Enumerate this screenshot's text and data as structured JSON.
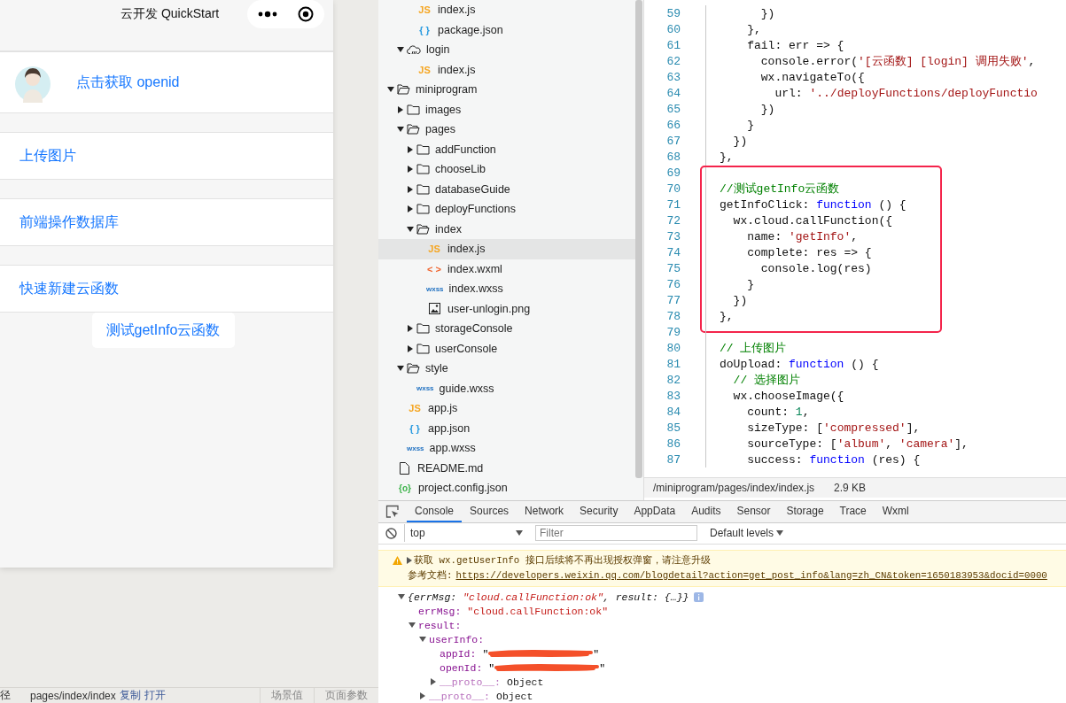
{
  "simulator": {
    "title": "云开发 QuickStart",
    "menu": [
      {
        "kind": "avatar",
        "label": "点击获取 openid"
      },
      {
        "kind": "plain",
        "label": "上传图片"
      },
      {
        "kind": "plain",
        "label": "前端操作数据库"
      },
      {
        "kind": "plain",
        "label": "快速新建云函数"
      },
      {
        "kind": "button",
        "label": "测试getInfo云函数"
      }
    ],
    "status_bar": {
      "path_label": "径",
      "path": "pages/index/index",
      "actions": [
        "复制",
        "打开"
      ],
      "buttons": [
        "场景值",
        "页面参数"
      ]
    }
  },
  "file_tree": {
    "items": [
      {
        "children": [
          {
            "children": [
              {
                "kind": "js",
                "badge": "JS",
                "label": "index.js",
                "selected": false
              },
              {
                "kind": "json",
                "badge": "{ }",
                "label": "package.json",
                "selected": false
              }
            ]
          },
          {
            "kind": "cloud-folder",
            "label": "login",
            "expanded": true,
            "children": [
              {
                "kind": "js",
                "badge": "JS",
                "label": "index.js",
                "selected": false
              }
            ]
          }
        ]
      },
      {
        "kind": "folder",
        "label": "miniprogram",
        "expanded": true,
        "children": [
          {
            "kind": "folder",
            "label": "images",
            "expanded": false
          },
          {
            "kind": "folder",
            "label": "pages",
            "expanded": true,
            "children": [
              {
                "kind": "folder",
                "label": "addFunction",
                "expanded": false
              },
              {
                "kind": "folder",
                "label": "chooseLib",
                "expanded": false
              },
              {
                "kind": "folder",
                "label": "databaseGuide",
                "expanded": false
              },
              {
                "kind": "folder",
                "label": "deployFunctions",
                "expanded": false
              },
              {
                "kind": "folder",
                "label": "index",
                "expanded": true,
                "children": [
                  {
                    "kind": "js",
                    "badge": "JS",
                    "label": "index.js",
                    "selected": true
                  },
                  {
                    "kind": "wxml",
                    "badge": "< >",
                    "label": "index.wxml",
                    "selected": false
                  },
                  {
                    "kind": "wxss",
                    "badge": "wxss",
                    "label": "index.wxss",
                    "selected": false
                  },
                  {
                    "kind": "image",
                    "label": "user-unlogin.png",
                    "selected": false
                  }
                ]
              },
              {
                "kind": "folder",
                "label": "storageConsole",
                "expanded": false
              },
              {
                "kind": "folder",
                "label": "userConsole",
                "expanded": false
              }
            ]
          },
          {
            "kind": "folder",
            "label": "style",
            "expanded": true,
            "children": [
              {
                "kind": "wxss",
                "badge": "wxss",
                "label": "guide.wxss",
                "selected": false
              }
            ]
          },
          {
            "kind": "js",
            "badge": "JS",
            "label": "app.js",
            "selected": false
          },
          {
            "kind": "json",
            "badge": "{ }",
            "label": "app.json",
            "selected": false
          },
          {
            "kind": "wxss",
            "badge": "wxss",
            "label": "app.wxss",
            "selected": false
          }
        ]
      },
      {
        "kind": "file",
        "label": "README.md",
        "selected": false
      },
      {
        "kind": "config",
        "badge": "{o}",
        "label": "project.config.json",
        "selected": false
      }
    ]
  },
  "editor": {
    "sections": [
      {
        "highlighted": false,
        "lines": [
          {
            "number": "59",
            "tokens": [
              {
                "kind": "plain",
                "text": "      })"
              }
            ]
          },
          {
            "number": "60",
            "tokens": [
              {
                "kind": "plain",
                "text": "    },"
              }
            ]
          },
          {
            "number": "61",
            "tokens": [
              {
                "kind": "plain",
                "text": "    fail: err => {"
              }
            ]
          },
          {
            "number": "62",
            "tokens": [
              {
                "kind": "plain",
                "text": "      console.error("
              },
              {
                "kind": "string",
                "text": "'[云函数] [login] 调用失败'"
              },
              {
                "kind": "plain",
                "text": ","
              }
            ]
          },
          {
            "number": "63",
            "tokens": [
              {
                "kind": "plain",
                "text": "      wx.navigateTo({"
              }
            ]
          },
          {
            "number": "64",
            "tokens": [
              {
                "kind": "plain",
                "text": "        url: "
              },
              {
                "kind": "string",
                "text": "'../deployFunctions/deployFunctio"
              }
            ]
          },
          {
            "number": "65",
            "tokens": [
              {
                "kind": "plain",
                "text": "      })"
              }
            ]
          },
          {
            "number": "66",
            "tokens": [
              {
                "kind": "plain",
                "text": "    }"
              }
            ]
          },
          {
            "number": "67",
            "tokens": [
              {
                "kind": "plain",
                "text": "  })"
              }
            ]
          },
          {
            "number": "68",
            "tokens": [
              {
                "kind": "plain",
                "text": "},"
              }
            ]
          },
          {
            "number": "69"
          }
        ]
      },
      {
        "highlighted": true,
        "lines": [
          {
            "number": "70",
            "tokens": [
              {
                "kind": "comment",
                "text": "//测试getInfo云函数"
              }
            ]
          },
          {
            "number": "71",
            "tokens": [
              {
                "kind": "plain",
                "text": "getInfoClick: "
              },
              {
                "kind": "keyword",
                "text": "function"
              },
              {
                "kind": "plain",
                "text": " () {"
              }
            ]
          },
          {
            "number": "72",
            "tokens": [
              {
                "kind": "plain",
                "text": "  wx.cloud.callFunction({"
              }
            ]
          },
          {
            "number": "73",
            "tokens": [
              {
                "kind": "plain",
                "text": "    name: "
              },
              {
                "kind": "string",
                "text": "'getInfo'"
              },
              {
                "kind": "plain",
                "text": ","
              }
            ]
          },
          {
            "number": "74",
            "tokens": [
              {
                "kind": "plain",
                "text": "    complete: res => {"
              }
            ]
          },
          {
            "number": "75",
            "tokens": [
              {
                "kind": "plain",
                "text": "      console.log(res)"
              }
            ]
          },
          {
            "number": "76",
            "tokens": [
              {
                "kind": "plain",
                "text": "    }"
              }
            ]
          },
          {
            "number": "77",
            "tokens": [
              {
                "kind": "plain",
                "text": "  })"
              }
            ]
          },
          {
            "number": "78",
            "tokens": [
              {
                "kind": "plain",
                "text": "},"
              }
            ]
          }
        ]
      },
      {
        "highlighted": false,
        "lines": [
          {
            "number": "79"
          },
          {
            "number": "80",
            "tokens": [
              {
                "kind": "comment",
                "text": "// 上传图片"
              }
            ]
          },
          {
            "number": "81",
            "tokens": [
              {
                "kind": "plain",
                "text": "doUpload: "
              },
              {
                "kind": "keyword",
                "text": "function"
              },
              {
                "kind": "plain",
                "text": " () {"
              }
            ]
          },
          {
            "number": "82",
            "tokens": [
              {
                "kind": "comment",
                "text": "  // 选择图片"
              }
            ]
          },
          {
            "number": "83",
            "tokens": [
              {
                "kind": "plain",
                "text": "  wx.chooseImage({"
              }
            ]
          },
          {
            "number": "84",
            "tokens": [
              {
                "kind": "plain",
                "text": "    count: "
              },
              {
                "kind": "number",
                "text": "1"
              },
              {
                "kind": "plain",
                "text": ","
              }
            ]
          },
          {
            "number": "85",
            "tokens": [
              {
                "kind": "plain",
                "text": "    sizeType: ["
              },
              {
                "kind": "string",
                "text": "'compressed'"
              },
              {
                "kind": "plain",
                "text": "],"
              }
            ]
          },
          {
            "number": "86",
            "tokens": [
              {
                "kind": "plain",
                "text": "    sourceType: ["
              },
              {
                "kind": "string",
                "text": "'album'"
              },
              {
                "kind": "plain",
                "text": ", "
              },
              {
                "kind": "string",
                "text": "'camera'"
              },
              {
                "kind": "plain",
                "text": "],"
              }
            ]
          },
          {
            "number": "87",
            "tokens": [
              {
                "kind": "plain",
                "text": "    success: "
              },
              {
                "kind": "keyword",
                "text": "function"
              },
              {
                "kind": "plain",
                "text": " (res) {"
              }
            ]
          }
        ]
      }
    ],
    "status": {
      "path": "/miniprogram/pages/index/index.js",
      "size": "2.9 KB"
    }
  },
  "devtools": {
    "tabs": [
      {
        "label": "Console",
        "selected": true
      },
      {
        "label": "Sources",
        "selected": false
      },
      {
        "label": "Network",
        "selected": false
      },
      {
        "label": "Security",
        "selected": false
      },
      {
        "label": "AppData",
        "selected": false
      },
      {
        "label": "Audits",
        "selected": false
      },
      {
        "label": "Sensor",
        "selected": false
      },
      {
        "label": "Storage",
        "selected": false
      },
      {
        "label": "Trace",
        "selected": false
      },
      {
        "label": "Wxml",
        "selected": false
      }
    ],
    "context": "top",
    "filter": {
      "placeholder": "Filter"
    },
    "levels": "Default levels",
    "warning": {
      "expanded": false,
      "message": "获取 wx.getUserInfo 接口后续将不再出现授权弹窗，请注意升级",
      "doc_label": "参考文档:",
      "doc_link": "https://developers.weixin.qq.com/blogdetail?action=get_post_info&lang=zh_CN&token=1650183953&docid=0000"
    },
    "result": {
      "expanded": true,
      "summary": [
        {
          "kind": "plain",
          "text": "{errMsg: "
        },
        {
          "kind": "string",
          "text": "\"cloud.callFunction:ok\""
        },
        {
          "kind": "plain",
          "text": ", result: {…}}"
        }
      ],
      "children": [
        {
          "kind": "string",
          "key": "errMsg:",
          "value": "\"cloud.callFunction:ok\""
        },
        {
          "kind": "object",
          "key": "result:",
          "expanded": true,
          "children": [
            {
              "kind": "object",
              "key": "userInfo:",
              "expanded": true,
              "children": [
                {
                  "kind": "redacted",
                  "key": "appId:",
                  "value": "\"",
                  "value_end": "\""
                },
                {
                  "kind": "redacted",
                  "key": "openId:",
                  "value": "\"",
                  "value_end": "\""
                },
                {
                  "kind": "proto",
                  "key": "__proto__:",
                  "value": "Object",
                  "expanded": false
                }
              ]
            },
            {
              "kind": "proto",
              "key": "__proto__:",
              "value": "Object",
              "expanded": false
            }
          ]
        }
      ]
    }
  }
}
